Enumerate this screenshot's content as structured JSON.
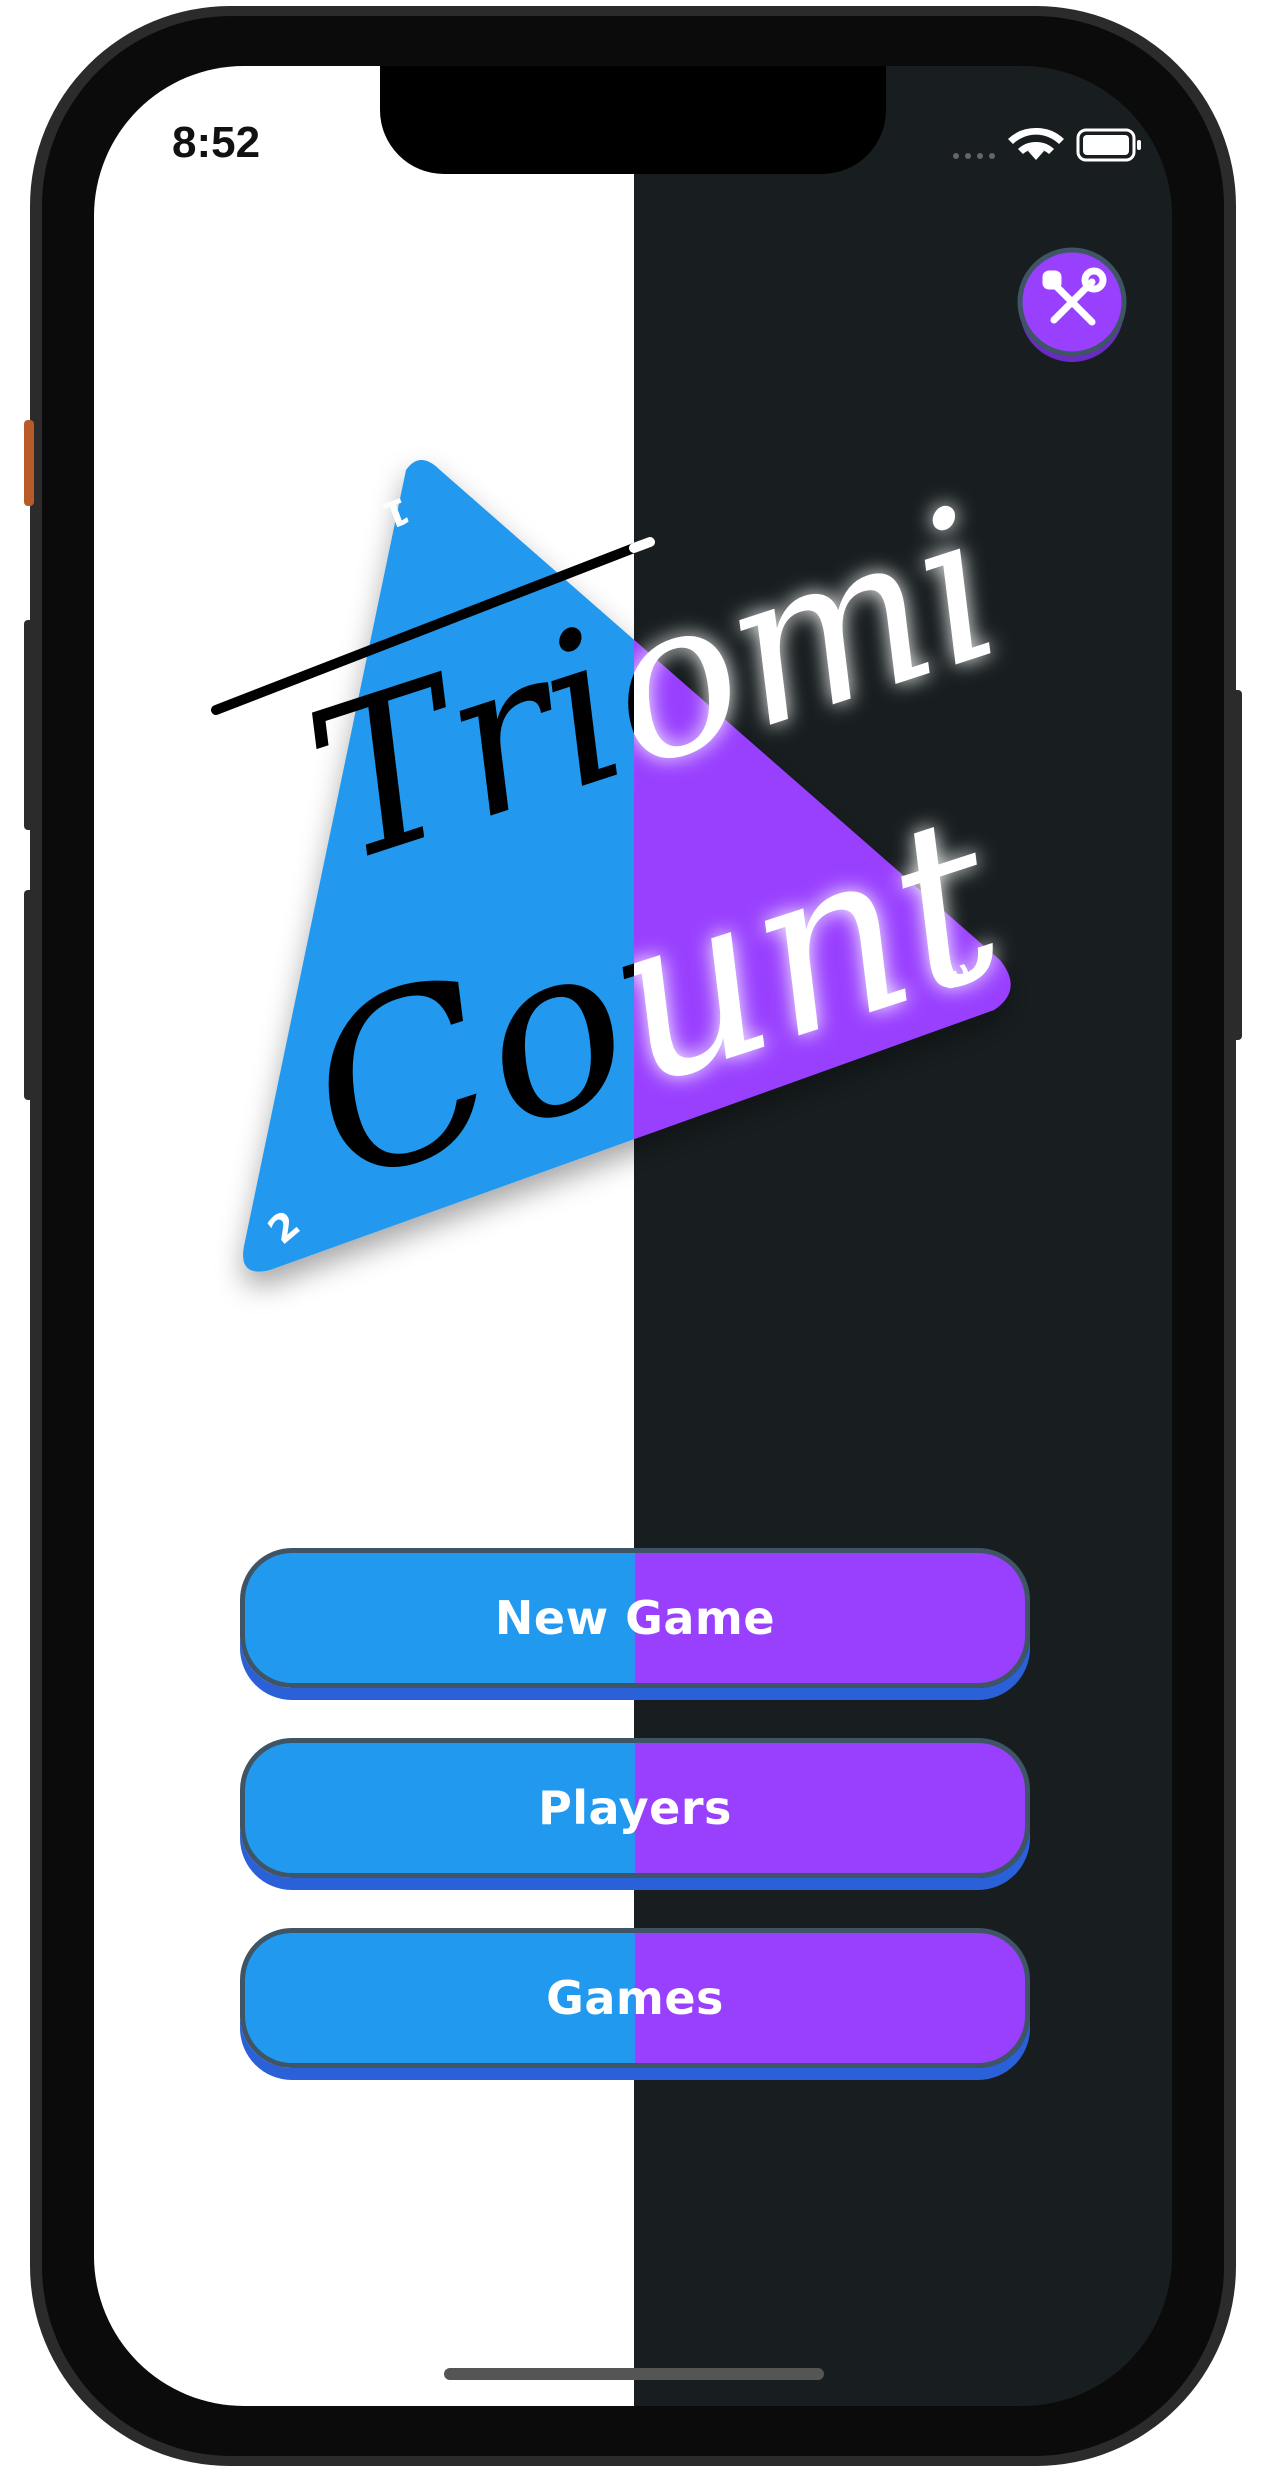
{
  "status_bar": {
    "time": "8:52",
    "icons": [
      "wifi-icon",
      "battery-icon"
    ]
  },
  "toolbar": {
    "tools_icon": "tools-icon"
  },
  "logo": {
    "title_line1": "Triomi",
    "title_line2": "Count",
    "corner_numbers": [
      "1",
      "2",
      "3"
    ]
  },
  "menu": {
    "new_game_label": "New Game",
    "players_label": "Players",
    "games_label": "Games"
  },
  "colors": {
    "light_bg": "#ffffff",
    "dark_bg": "#181e20",
    "light_accent": "#2199ee",
    "dark_accent": "#9940ff"
  }
}
